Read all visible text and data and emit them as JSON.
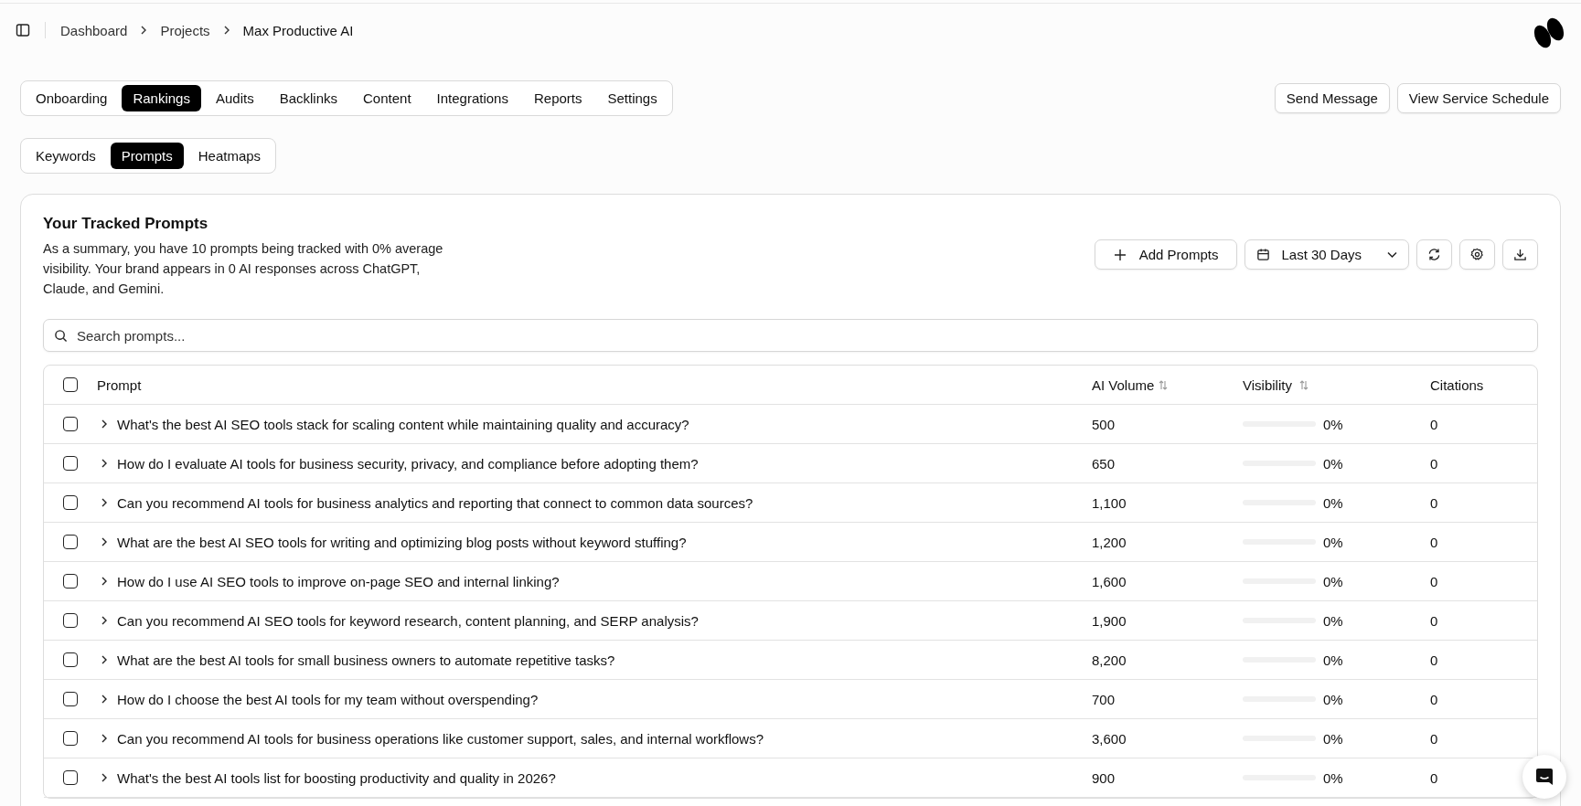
{
  "breadcrumb": [
    "Dashboard",
    "Projects",
    "Max Productive AI"
  ],
  "main_tabs": [
    {
      "label": "Onboarding",
      "selected": false
    },
    {
      "label": "Rankings",
      "selected": true
    },
    {
      "label": "Audits",
      "selected": false
    },
    {
      "label": "Backlinks",
      "selected": false
    },
    {
      "label": "Content",
      "selected": false
    },
    {
      "label": "Integrations",
      "selected": false
    },
    {
      "label": "Reports",
      "selected": false
    },
    {
      "label": "Settings",
      "selected": false
    }
  ],
  "header_buttons": [
    "Send Message",
    "View Service Schedule"
  ],
  "sub_tabs": [
    {
      "label": "Keywords",
      "selected": false
    },
    {
      "label": "Prompts",
      "selected": true
    },
    {
      "label": "Heatmaps",
      "selected": false
    }
  ],
  "card": {
    "title": "Your Tracked Prompts",
    "summary": "As a summary, you have 10 prompts being tracked with 0% average visibility. Your brand appears in 0 AI responses across ChatGPT, Claude, and Gemini.",
    "add_button": "Add Prompts",
    "date_range": "Last 30 Days"
  },
  "search": {
    "placeholder": "Search prompts..."
  },
  "table": {
    "select_all_checked": false,
    "columns": [
      "Prompt",
      "AI Volume",
      "Visibility",
      "Citations"
    ],
    "rows": [
      {
        "checked": false,
        "prompt": "What's the best AI SEO tools stack for scaling content while maintaining quality and accuracy?",
        "volume": "500",
        "level": 0,
        "visibility": "0%",
        "citations": "0"
      },
      {
        "checked": false,
        "prompt": "How do I evaluate AI tools for business security, privacy, and compliance before adopting them?",
        "volume": "650",
        "level": 0,
        "visibility": "0%",
        "citations": "0"
      },
      {
        "checked": false,
        "prompt": "Can you recommend AI tools for business analytics and reporting that connect to common data sources?",
        "volume": "1,100",
        "level": 0,
        "visibility": "0%",
        "citations": "0"
      },
      {
        "checked": false,
        "prompt": "What are the best AI SEO tools for writing and optimizing blog posts without keyword stuffing?",
        "volume": "1,200",
        "level": 0,
        "visibility": "0%",
        "citations": "0"
      },
      {
        "checked": false,
        "prompt": "How do I use AI SEO tools to improve on-page SEO and internal linking?",
        "volume": "1,600",
        "level": 0,
        "visibility": "0%",
        "citations": "0"
      },
      {
        "checked": false,
        "prompt": "Can you recommend AI SEO tools for keyword research, content planning, and SERP analysis?",
        "volume": "1,900",
        "level": 0,
        "visibility": "0%",
        "citations": "0"
      },
      {
        "checked": false,
        "prompt": "What are the best AI tools for small business owners to automate repetitive tasks?",
        "volume": "8,200",
        "level": 0,
        "visibility": "0%",
        "citations": "0"
      },
      {
        "checked": false,
        "prompt": "How do I choose the best AI tools for my team without overspending?",
        "volume": "700",
        "level": 0,
        "visibility": "0%",
        "citations": "0"
      },
      {
        "checked": false,
        "prompt": "Can you recommend AI tools for business operations like customer support, sales, and internal workflows?",
        "volume": "3,600",
        "level": 0,
        "visibility": "0%",
        "citations": "0"
      },
      {
        "checked": false,
        "prompt": "What's the best AI tools list for boosting productivity and quality in 2026?",
        "volume": "900",
        "level": 0,
        "visibility": "0%",
        "citations": "0"
      }
    ]
  }
}
